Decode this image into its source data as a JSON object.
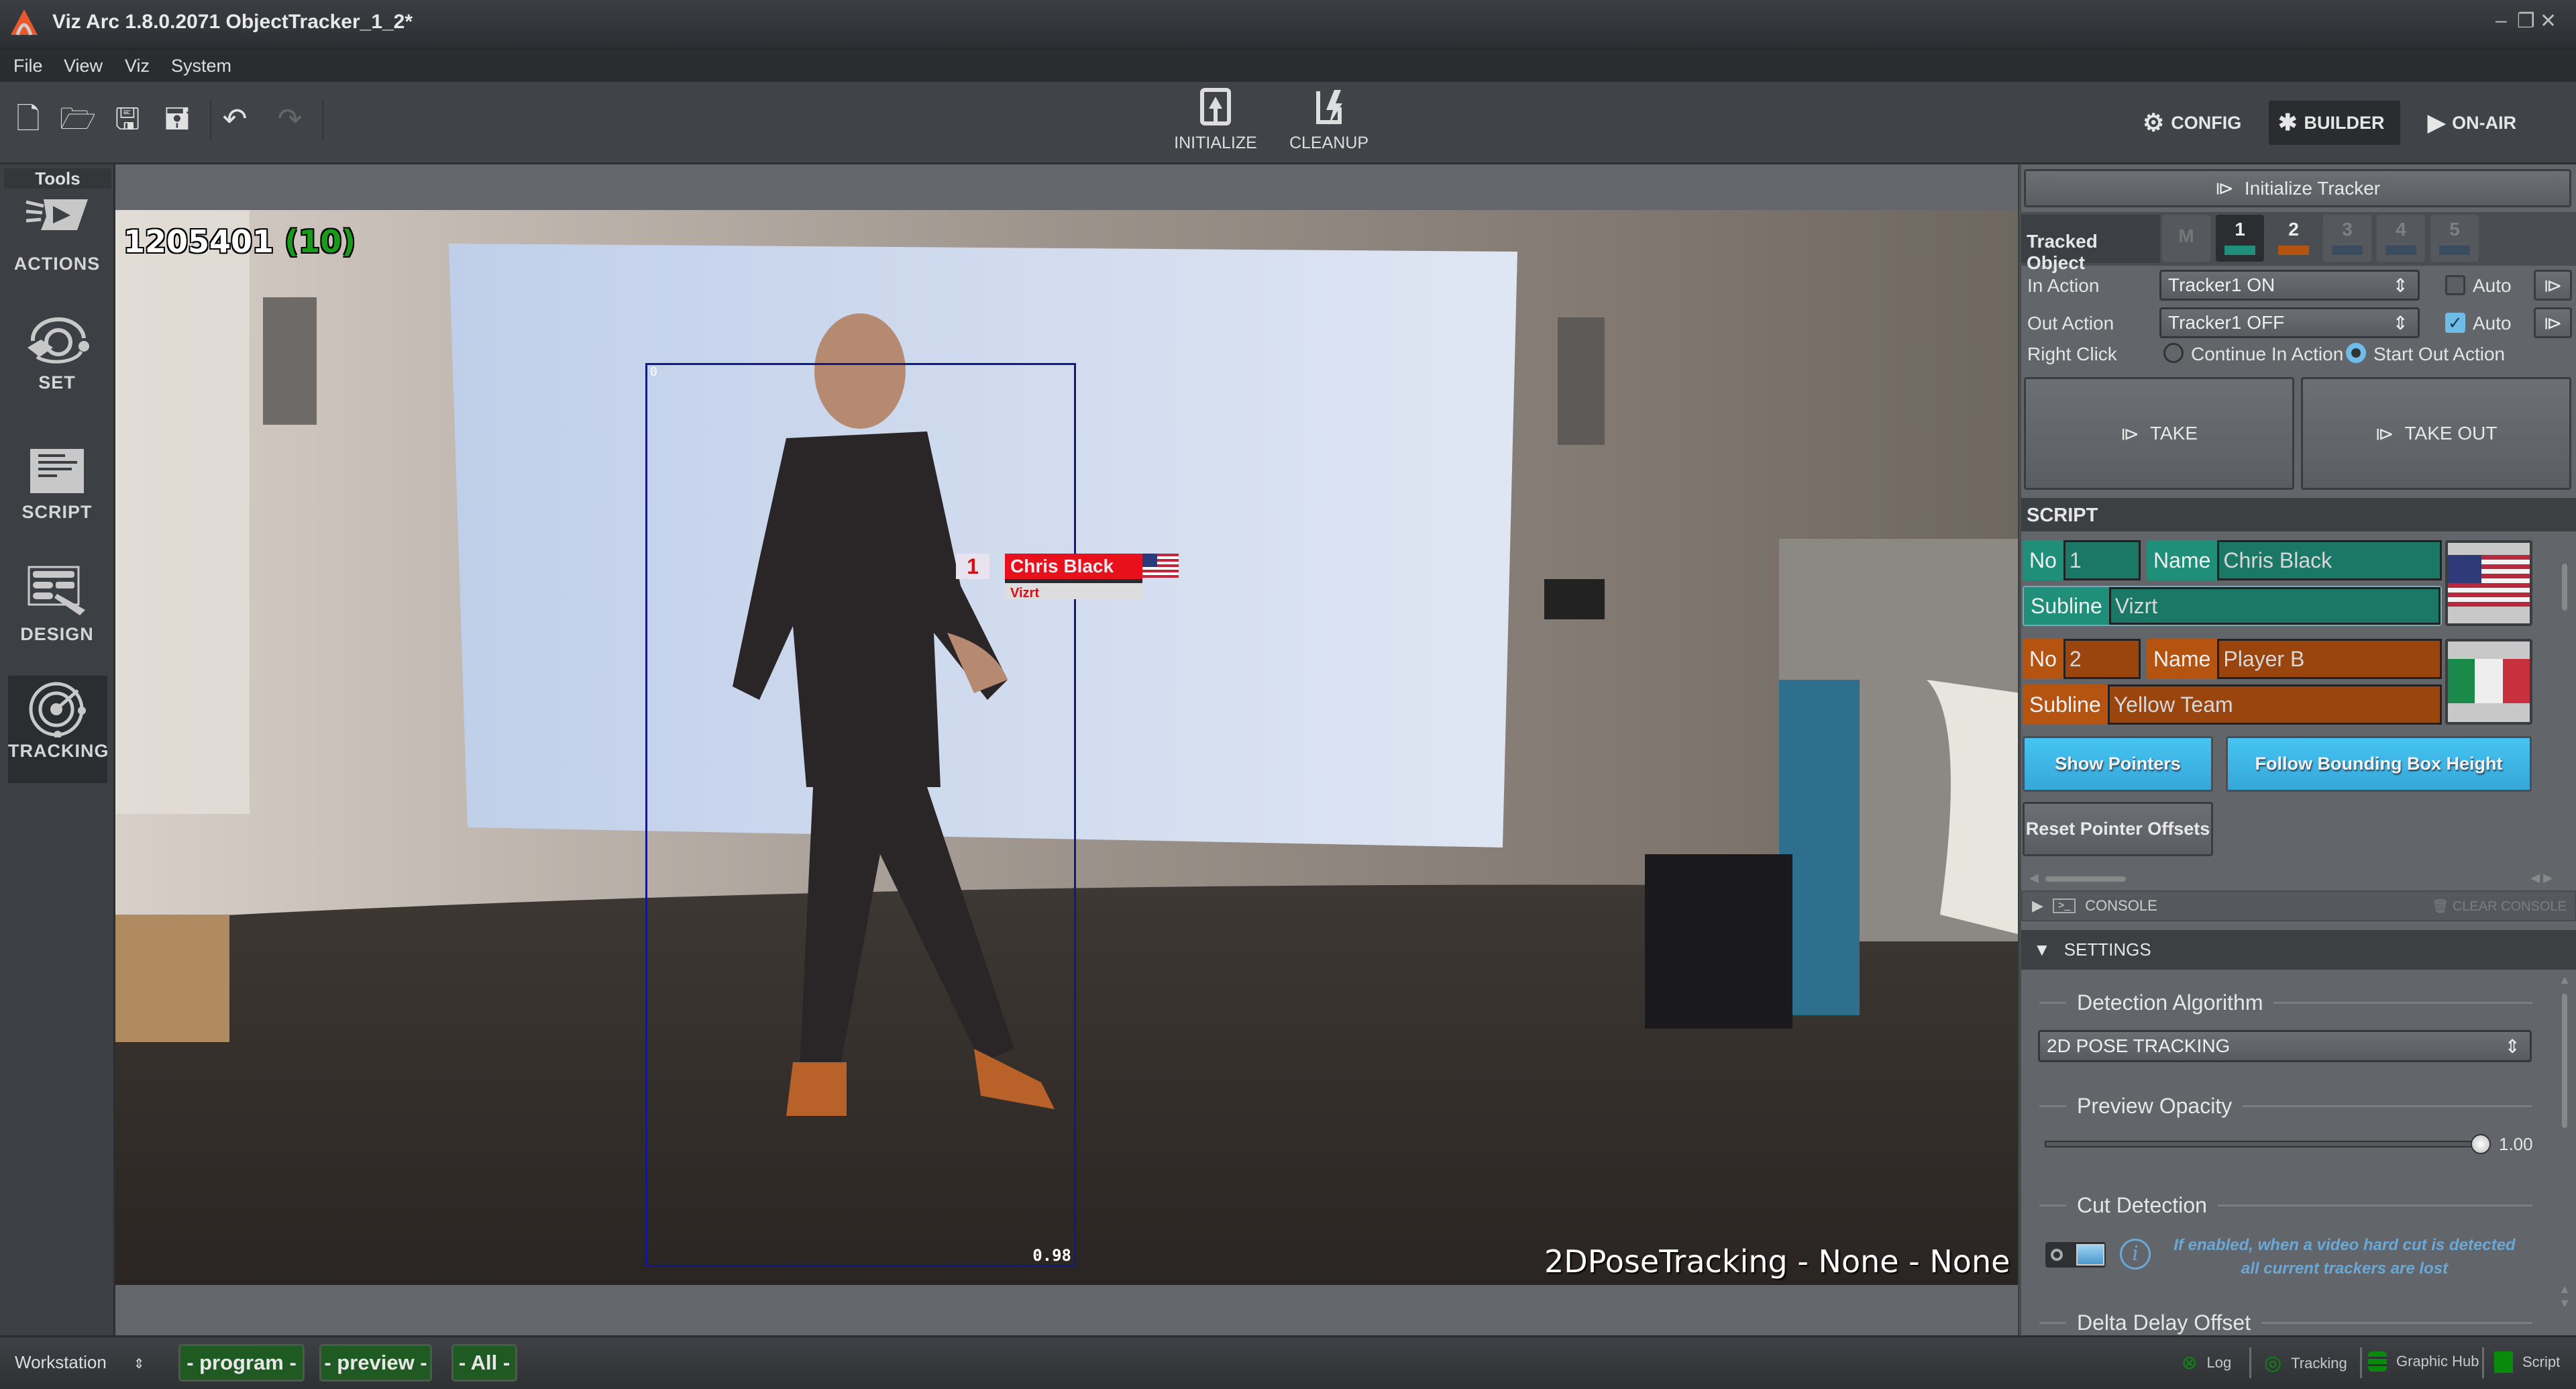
{
  "window": {
    "title": "Viz Arc 1.8.0.2071 ObjectTracker_1_2*",
    "controls": [
      "minimize",
      "restore",
      "close"
    ]
  },
  "menu": [
    "File",
    "View",
    "Viz",
    "System"
  ],
  "toolbar": {
    "icons": [
      "new-file-icon",
      "open-folder-icon",
      "save-icon",
      "save-as-icon",
      "undo-icon",
      "redo-icon"
    ],
    "initialize": "INITIALIZE",
    "cleanup": "CLEANUP",
    "modes": {
      "config": "CONFIG",
      "builder": "BUILDER",
      "onair": "ON-AIR",
      "active": "BUILDER"
    }
  },
  "tools": {
    "header": "Tools",
    "items": [
      {
        "label": "ACTIONS",
        "icon": "actions-icon"
      },
      {
        "label": "SET",
        "icon": "set-icon"
      },
      {
        "label": "SCRIPT",
        "icon": "script-icon"
      },
      {
        "label": "DESIGN",
        "icon": "design-icon"
      },
      {
        "label": "TRACKING",
        "icon": "tracking-icon",
        "active": true
      }
    ]
  },
  "video": {
    "frame_counter": "1205401",
    "frame_counter_paren": "(10)",
    "bbox_id": "0",
    "bbox_confidence": "0.98",
    "mode_text": "2DPoseTracking - None - None",
    "lower_third": {
      "number": "1",
      "name": "Chris Black",
      "subline": "Vizrt"
    }
  },
  "panel": {
    "init_tracker": "Initialize Tracker",
    "tracked_object_label": "Tracked Object",
    "tabs": [
      {
        "label": "M",
        "color": "#5a5e62"
      },
      {
        "label": "1",
        "color": "#1f8f79",
        "active": true
      },
      {
        "label": "2",
        "color": "#b55311"
      },
      {
        "label": "3",
        "color": "#3a4c5e"
      },
      {
        "label": "4",
        "color": "#3a4c5e"
      },
      {
        "label": "5",
        "color": "#3a4c5e"
      }
    ],
    "in_action": {
      "label": "In Action",
      "value": "Tracker1 ON",
      "auto_label": "Auto",
      "auto": false
    },
    "out_action": {
      "label": "Out Action",
      "value": "Tracker1 OFF",
      "auto_label": "Auto",
      "auto": true
    },
    "right_click": {
      "label": "Right Click",
      "opt1": "Continue In Action",
      "opt2": "Start Out Action",
      "selected": "Start Out Action"
    },
    "take": "TAKE",
    "take_out": "TAKE OUT",
    "script_header": "SCRIPT",
    "entries": [
      {
        "no_label": "No",
        "no": "1",
        "name_label": "Name",
        "name": "Chris Black",
        "subline_label": "Subline",
        "subline": "Vizrt",
        "flag": "usa-flag",
        "color": "#1f8f79"
      },
      {
        "no_label": "No",
        "no": "2",
        "name_label": "Name",
        "name": "Player B",
        "subline_label": "Subline",
        "subline": "Yellow Team",
        "flag": "italy-flag",
        "color": "#b55311"
      }
    ],
    "show_pointers": "Show Pointers",
    "follow_bbox": "Follow Bounding Box Height",
    "reset_offsets": "Reset Pointer Offsets",
    "console": "CONSOLE",
    "clear_console": "CLEAR CONSOLE",
    "settings": "SETTINGS",
    "detection_algorithm": {
      "label": "Detection Algorithm",
      "value": "2D POSE TRACKING"
    },
    "preview_opacity": {
      "label": "Preview Opacity",
      "value": "1.00",
      "fraction": 1.0
    },
    "cut_detection": {
      "label": "Cut Detection",
      "info_line1": "If enabled, when a video hard cut is detected",
      "info_line2": "all current trackers are lost"
    },
    "delta_delay": {
      "label": "Delta Delay Offset"
    }
  },
  "status": {
    "workstation": "Workstation",
    "program": "- program -",
    "preview": "- preview -",
    "all": "- All -",
    "items": [
      "Log",
      "Tracking",
      "Graphic Hub",
      "Script"
    ]
  },
  "colors": {
    "accent_teal": "#1f8f79",
    "accent_orange": "#b55311",
    "button_blue": "#3ab4e6",
    "status_green": "#1f5a22"
  }
}
